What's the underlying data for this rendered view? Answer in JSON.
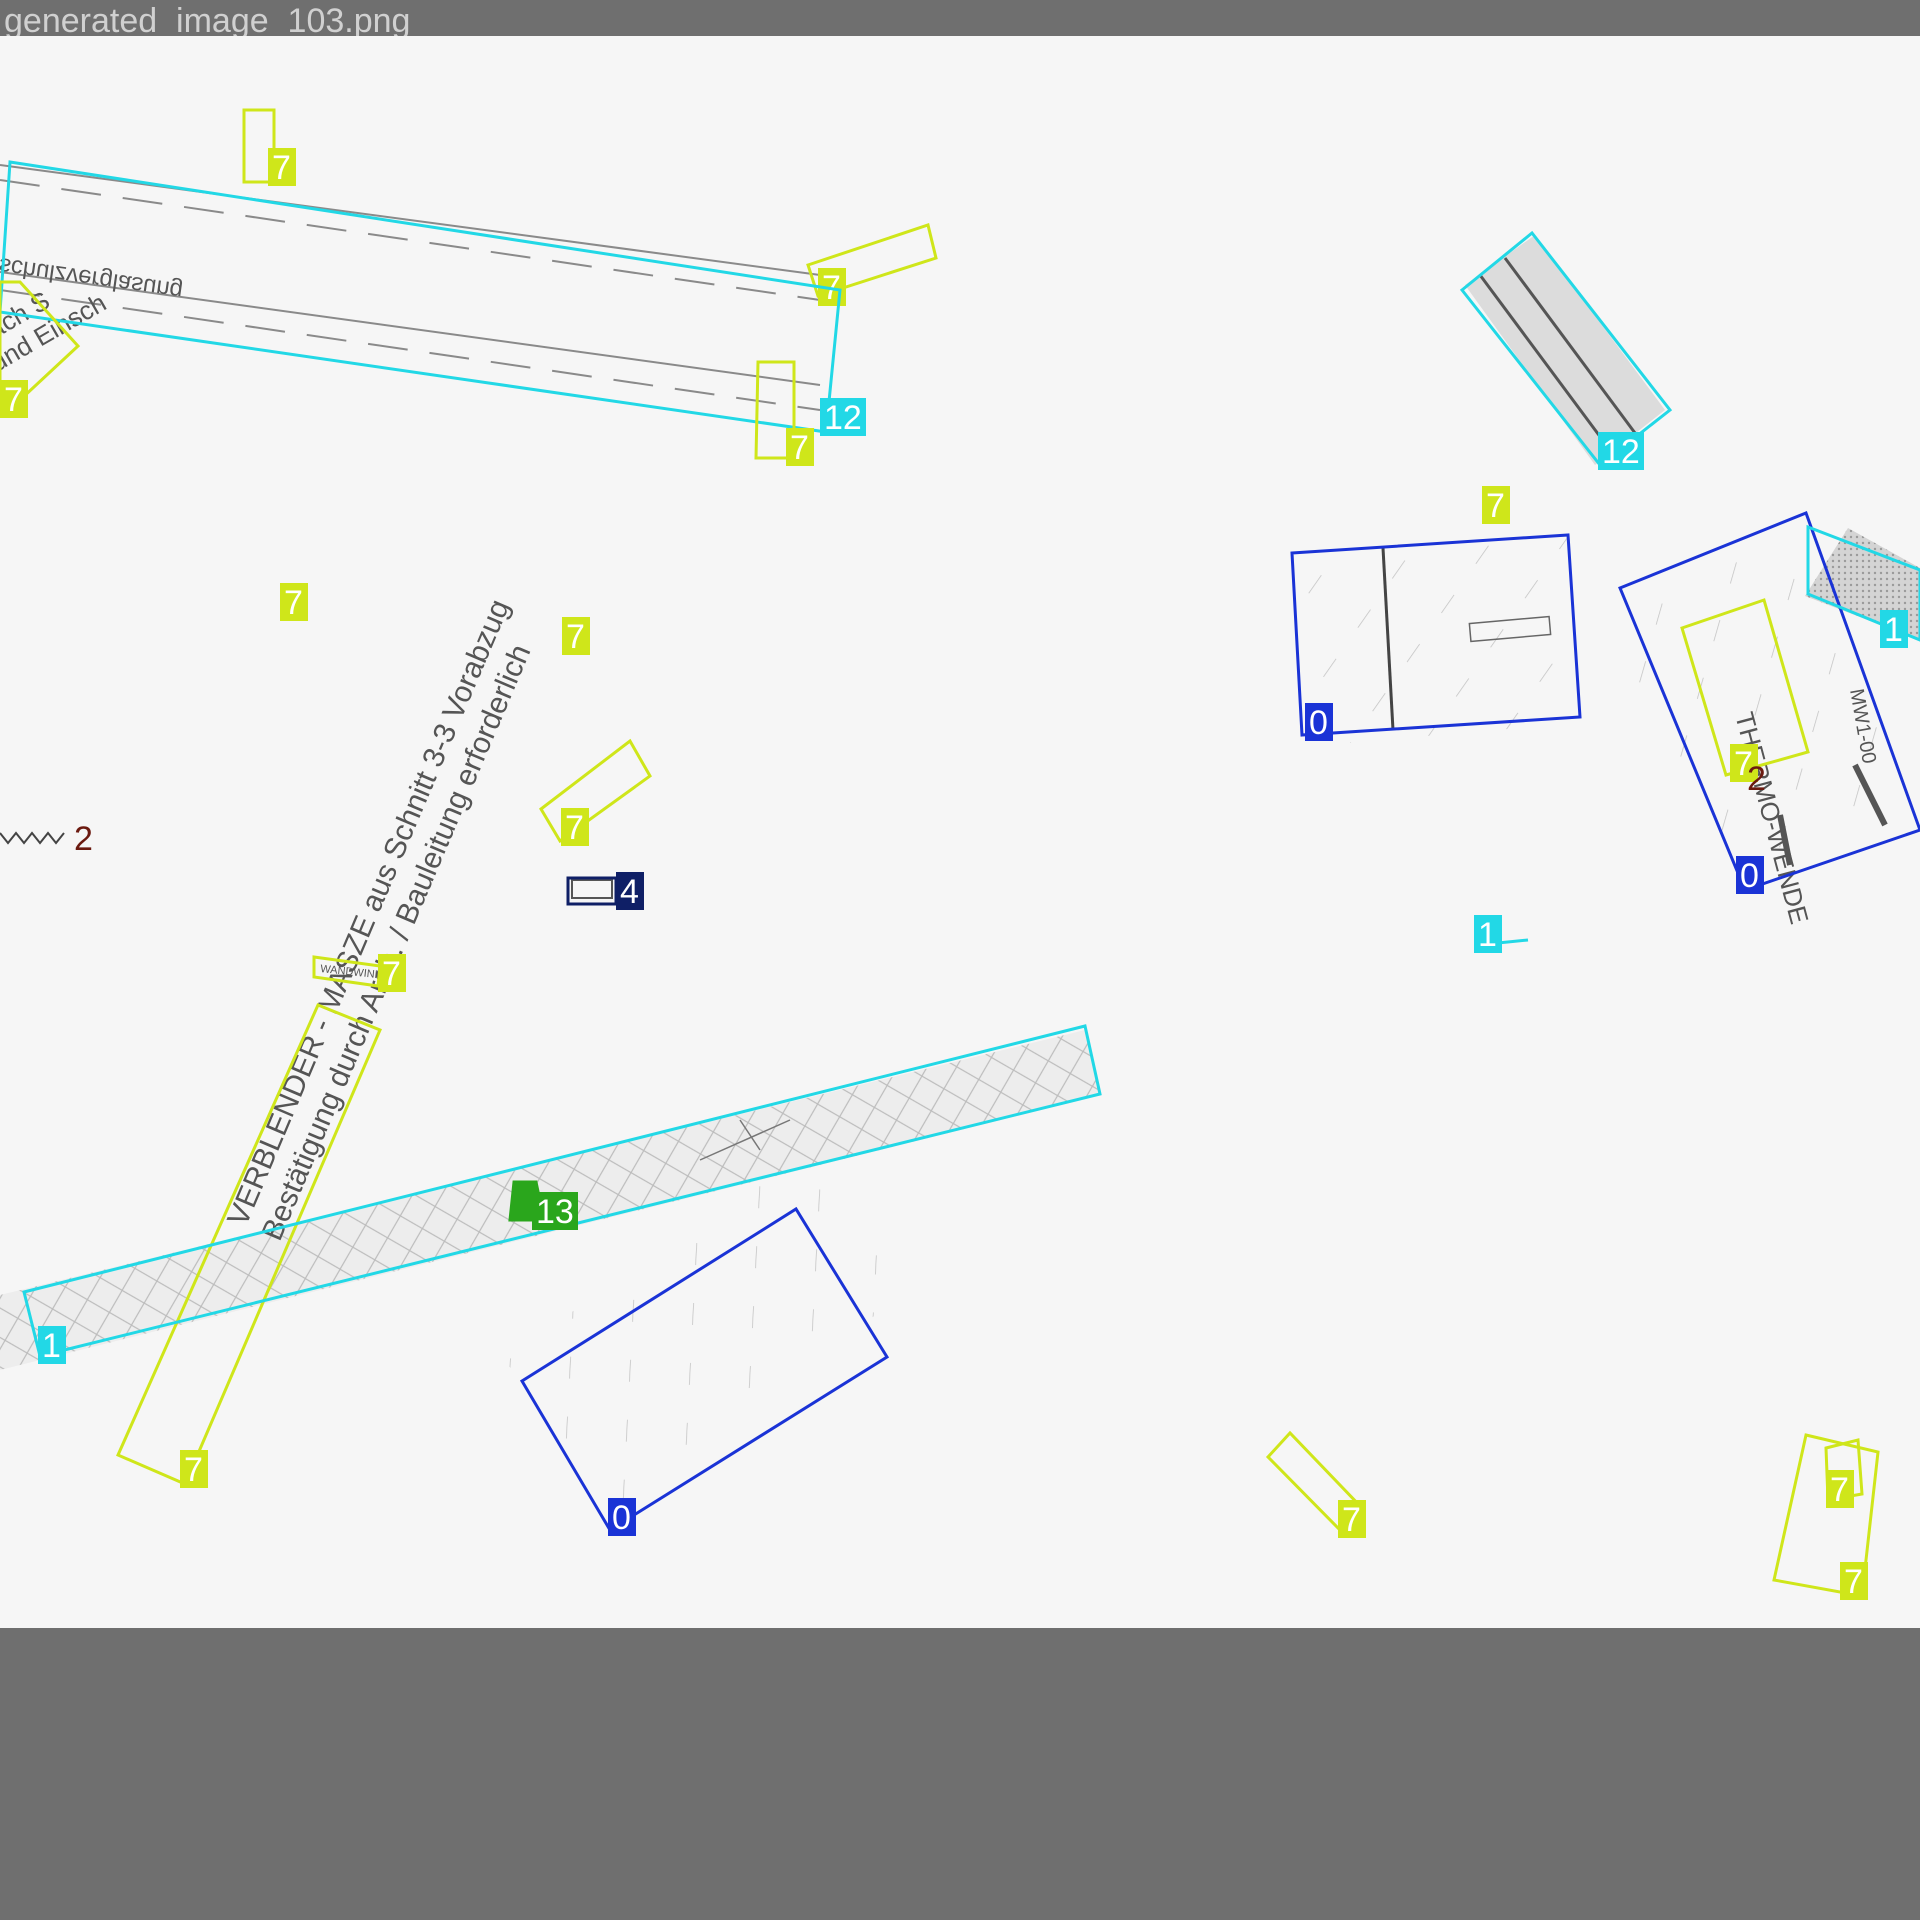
{
  "image_title": "generated_image_103.png",
  "colors": {
    "class_0": "#1a33d6",
    "class_1": "#22d8e6",
    "class_2": "#6b1a10",
    "class_4": "#0f1f66",
    "class_7": "#cfe61a",
    "class_12": "#22d8e6",
    "class_13": "#2aa61c",
    "background": "#f6f6f6",
    "frame": "#6f6f6f"
  },
  "drawing_text": {
    "dimension_line": "schulzverglasung",
    "hatch_note": "und Einsch",
    "hatch_note_2": "nach S",
    "big_warning_1": "VERBLENDER - MASZE aus Schnitt 3-3 Vorabzug",
    "big_warning_2": "Bestätigung durch Arch. / Bauleitung erforderlich",
    "thermo_label": "THERMO-WENDE",
    "level_label": "MW1-00",
    "wall_tag": "WANDWINKEL"
  },
  "annotations": [
    {
      "class": "7",
      "label": "7"
    },
    {
      "class": "7",
      "label": "7"
    },
    {
      "class": "12",
      "label": "12"
    },
    {
      "class": "7",
      "label": "7"
    },
    {
      "class": "7",
      "label": "7"
    },
    {
      "class": "12",
      "label": "12"
    },
    {
      "class": "7",
      "label": "7"
    },
    {
      "class": "0",
      "label": "0"
    },
    {
      "class": "0",
      "label": "0"
    },
    {
      "class": "1",
      "label": "1"
    },
    {
      "class": "7",
      "label": "7"
    },
    {
      "class": "2",
      "label": "2"
    },
    {
      "class": "7",
      "label": "7"
    },
    {
      "class": "7",
      "label": "7"
    },
    {
      "class": "7",
      "label": "7"
    },
    {
      "class": "2",
      "label": "2"
    },
    {
      "class": "4",
      "label": "4"
    },
    {
      "class": "1",
      "label": "1"
    },
    {
      "class": "7",
      "label": "7"
    },
    {
      "class": "7",
      "label": "7"
    },
    {
      "class": "1",
      "label": "1"
    },
    {
      "class": "13",
      "label": "13"
    },
    {
      "class": "0",
      "label": "0"
    },
    {
      "class": "7",
      "label": "7"
    },
    {
      "class": "7",
      "label": "7"
    },
    {
      "class": "7",
      "label": "7"
    }
  ]
}
